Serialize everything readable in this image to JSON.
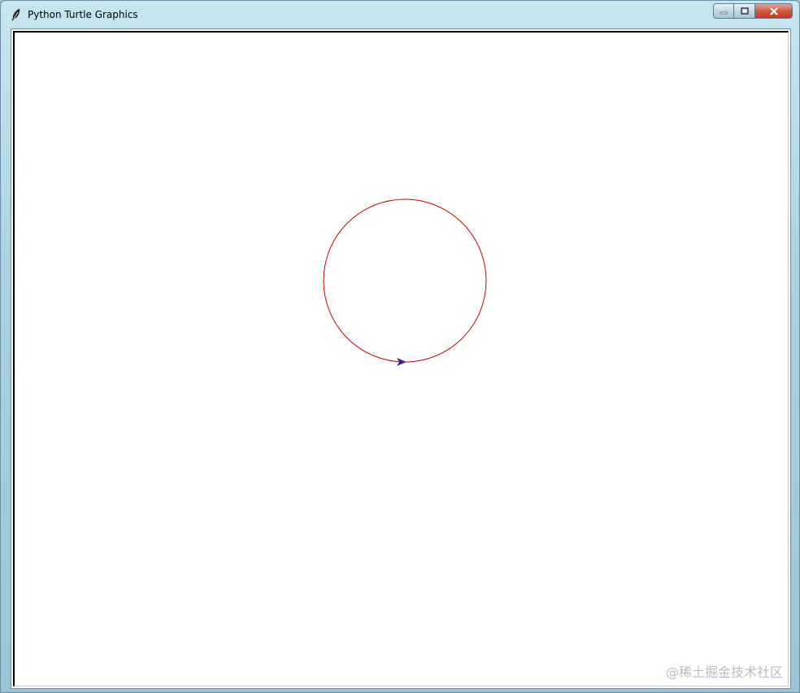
{
  "window": {
    "title": "Python Turtle Graphics",
    "icon": "feather-icon",
    "controls": {
      "minimize_icon": "minimize-icon",
      "maximize_icon": "maximize-icon",
      "close_icon": "close-icon"
    }
  },
  "canvas": {
    "background": "#ffffff",
    "circle": {
      "stroke_color": "#cc0000"
    },
    "turtle": {
      "fill_color": "#3a1fa0",
      "heading": "east"
    }
  },
  "watermark": {
    "text": "@稀土掘金技术社区"
  }
}
